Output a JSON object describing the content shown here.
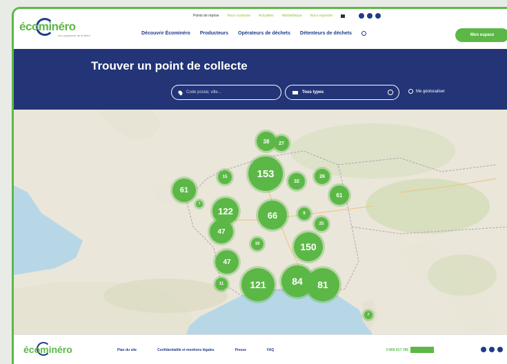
{
  "brand": {
    "name": "écominéro",
    "tagline": "éco-organisme de la filière"
  },
  "top_links": [
    {
      "label": "Points de reprise",
      "style": "dark"
    },
    {
      "label": "Nous contacter",
      "style": "green"
    },
    {
      "label": "Actualités",
      "style": "green"
    },
    {
      "label": "Médiathèque",
      "style": "green"
    },
    {
      "label": "Nous rejoindre",
      "style": "green"
    }
  ],
  "nav": [
    "Découvrir Écominéro",
    "Producteurs",
    "Opérateurs de déchets",
    "Détenteurs de déchets"
  ],
  "cta_label": "Mon espace",
  "banner": {
    "title": "Trouver un point de collecte",
    "location_placeholder": "Code postal, ville...",
    "type_value": "Tous types",
    "geolocate_label": "Me géolocaliser"
  },
  "clusters": [
    {
      "label": "38"
    },
    {
      "label": "27"
    },
    {
      "label": "153"
    },
    {
      "label": "15"
    },
    {
      "label": "61"
    },
    {
      "label": "32"
    },
    {
      "label": "26"
    },
    {
      "label": "61"
    },
    {
      "label": "122"
    },
    {
      "label": "66"
    },
    {
      "label": "9"
    },
    {
      "label": "25"
    },
    {
      "label": "47"
    },
    {
      "label": "150"
    },
    {
      "label": "19"
    },
    {
      "label": "47"
    },
    {
      "label": "121"
    },
    {
      "label": "84"
    },
    {
      "label": "81"
    },
    {
      "label": "11"
    },
    {
      "label": "7"
    },
    {
      "label": "7"
    }
  ],
  "footer": {
    "links": [
      "Plan du site",
      "Confidentialité et mentions légales",
      "Presse",
      "FAQ"
    ],
    "phone": "0 805 017 785"
  },
  "colors": {
    "brand_green": "#5cb846",
    "brand_blue": "#233577"
  }
}
